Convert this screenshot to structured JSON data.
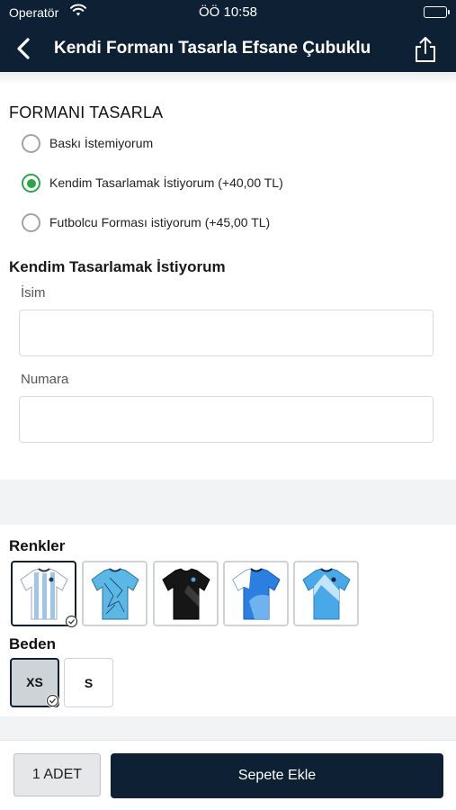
{
  "status_bar": {
    "carrier": "Operatör",
    "time": "ÖÖ 10:58"
  },
  "nav": {
    "title": "Kendi Formanı Tasarla Efsane Çubuklu"
  },
  "design": {
    "section_title": "FORMANI TASARLA",
    "options": [
      {
        "label": "Baskı İstemiyorum",
        "checked": false
      },
      {
        "label": "Kendim Tasarlamak İstiyorum (+40,00 TL)",
        "checked": true
      },
      {
        "label": "Futbolcu Forması istiyorum (+45,00 TL)",
        "checked": false
      }
    ],
    "subtitle": "Kendim Tasarlamak İstiyorum",
    "name_label": "İsim",
    "name_value": "",
    "number_label": "Numara",
    "number_value": ""
  },
  "colors": {
    "title": "Renkler",
    "swatches": [
      {
        "name": "striped-light-blue-jersey",
        "selected": true,
        "primary": "#9fc6ea",
        "secondary": "#ffffff"
      },
      {
        "name": "light-blue-graphic-jersey",
        "selected": false,
        "primary": "#5bb7e6",
        "secondary": "#1f3c5a"
      },
      {
        "name": "black-jersey",
        "selected": false,
        "primary": "#161616",
        "secondary": "#3a3a3a"
      },
      {
        "name": "blue-white-jersey",
        "selected": false,
        "primary": "#2a7fe0",
        "secondary": "#ffffff"
      },
      {
        "name": "sky-blue-pattern-jersey",
        "selected": false,
        "primary": "#49a8e8",
        "secondary": "#d8eefc"
      }
    ]
  },
  "sizes": {
    "title": "Beden",
    "options": [
      {
        "label": "XS",
        "selected": true
      },
      {
        "label": "S",
        "selected": false
      }
    ]
  },
  "footer": {
    "quantity_label": "1 ADET",
    "add_to_cart_label": "Sepete Ekle"
  },
  "theme": {
    "navy": "#0e2033",
    "green": "#2aa745"
  }
}
